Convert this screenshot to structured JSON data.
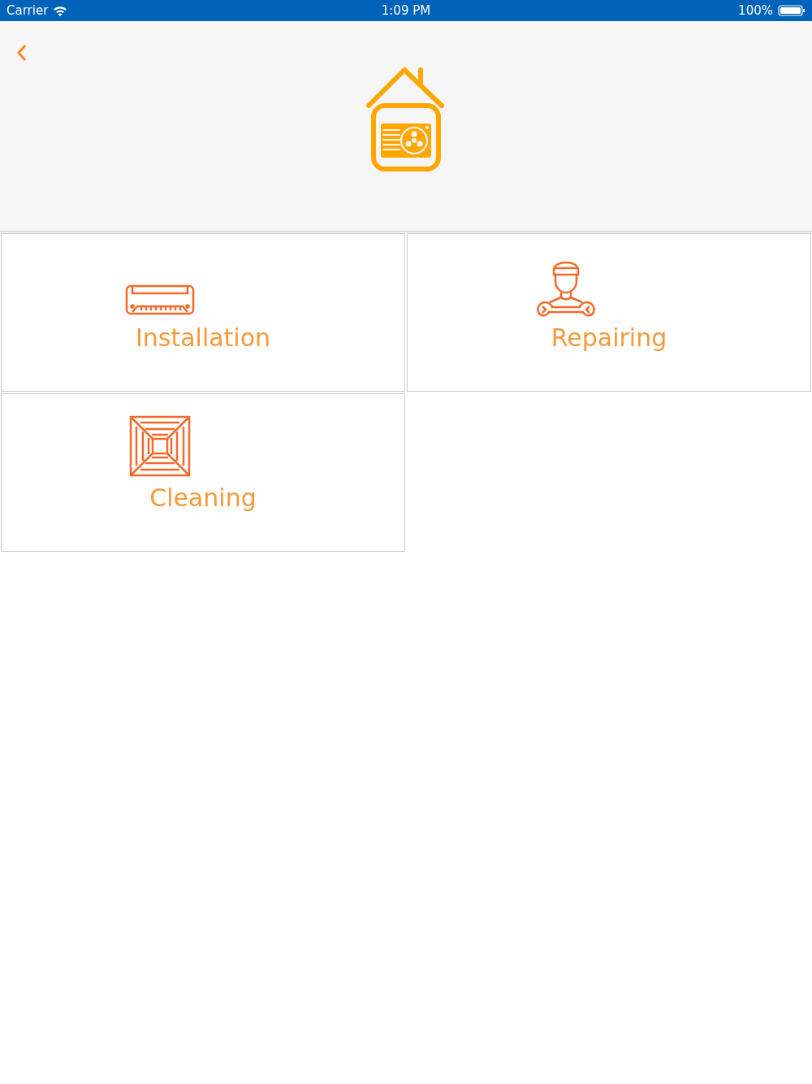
{
  "status_bar": {
    "carrier": "Carrier",
    "time": "1:09 PM",
    "battery": "100%"
  },
  "services": [
    {
      "kind": "installation",
      "label": "Installation"
    },
    {
      "kind": "repair",
      "label": "Repairing"
    },
    {
      "kind": "cleaning",
      "label": "Cleaning"
    }
  ]
}
